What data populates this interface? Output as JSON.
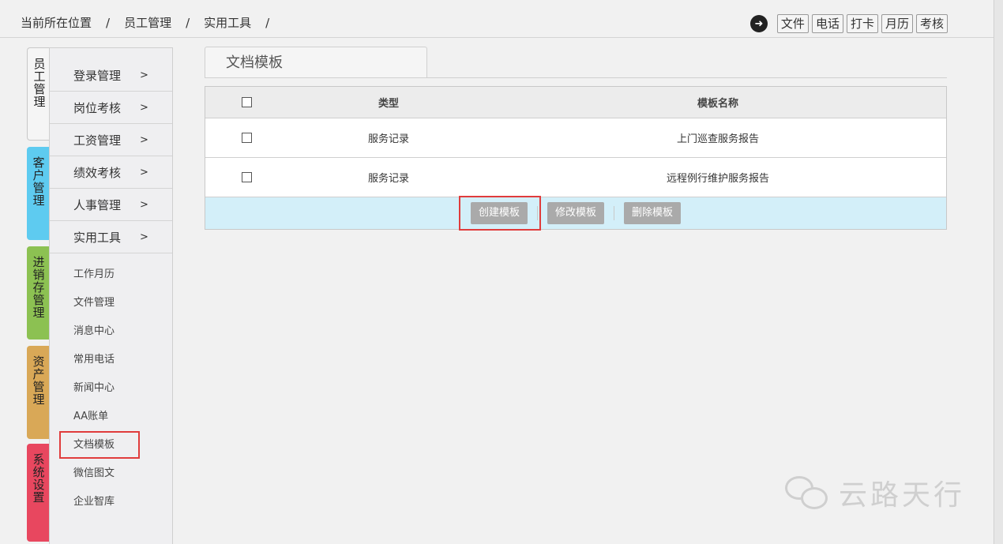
{
  "breadcrumb": {
    "items": [
      "当前所在位置",
      "员工管理",
      "实用工具"
    ],
    "separator": "/"
  },
  "quicklinks": {
    "icon": "arrow-right-circle-icon",
    "items": [
      "文件",
      "电话",
      "打卡",
      "月历",
      "考核"
    ]
  },
  "vtabs": [
    {
      "label": "员工管理",
      "color": "#f5f5f5"
    },
    {
      "label": "客户管理",
      "color": "#5ecbf0"
    },
    {
      "label": "进销存管理",
      "color": "#8cc152"
    },
    {
      "label": "资产管理",
      "color": "#d9a857"
    },
    {
      "label": "系统设置",
      "color": "#e8475f"
    }
  ],
  "sidebar": {
    "menu": [
      {
        "label": "登录管理",
        "chev": ">"
      },
      {
        "label": "岗位考核",
        "chev": ">"
      },
      {
        "label": "工资管理",
        "chev": ">"
      },
      {
        "label": "绩效考核",
        "chev": ">"
      },
      {
        "label": "人事管理",
        "chev": ">"
      },
      {
        "label": "实用工具",
        "chev": ">"
      }
    ],
    "submenu": [
      "工作月历",
      "文件管理",
      "消息中心",
      "常用电话",
      "新闻中心",
      "AA账单",
      "文档模板",
      "微信图文",
      "企业智库"
    ],
    "active_submenu": "文档模板"
  },
  "content": {
    "tab_title": "文档模板",
    "table": {
      "headers": {
        "type": "类型",
        "name": "模板名称"
      },
      "rows": [
        {
          "type": "服务记录",
          "name": "上门巡查服务报告"
        },
        {
          "type": "服务记录",
          "name": "远程例行维护服务报告"
        }
      ]
    },
    "actions": {
      "create": "创建模板",
      "edit": "修改模板",
      "delete": "删除模板"
    }
  },
  "watermark": {
    "text": "云路天行"
  },
  "colors": {
    "highlight": "#e03c3c",
    "action_bar": "#d3eff9",
    "button": "#aaaaaa"
  }
}
